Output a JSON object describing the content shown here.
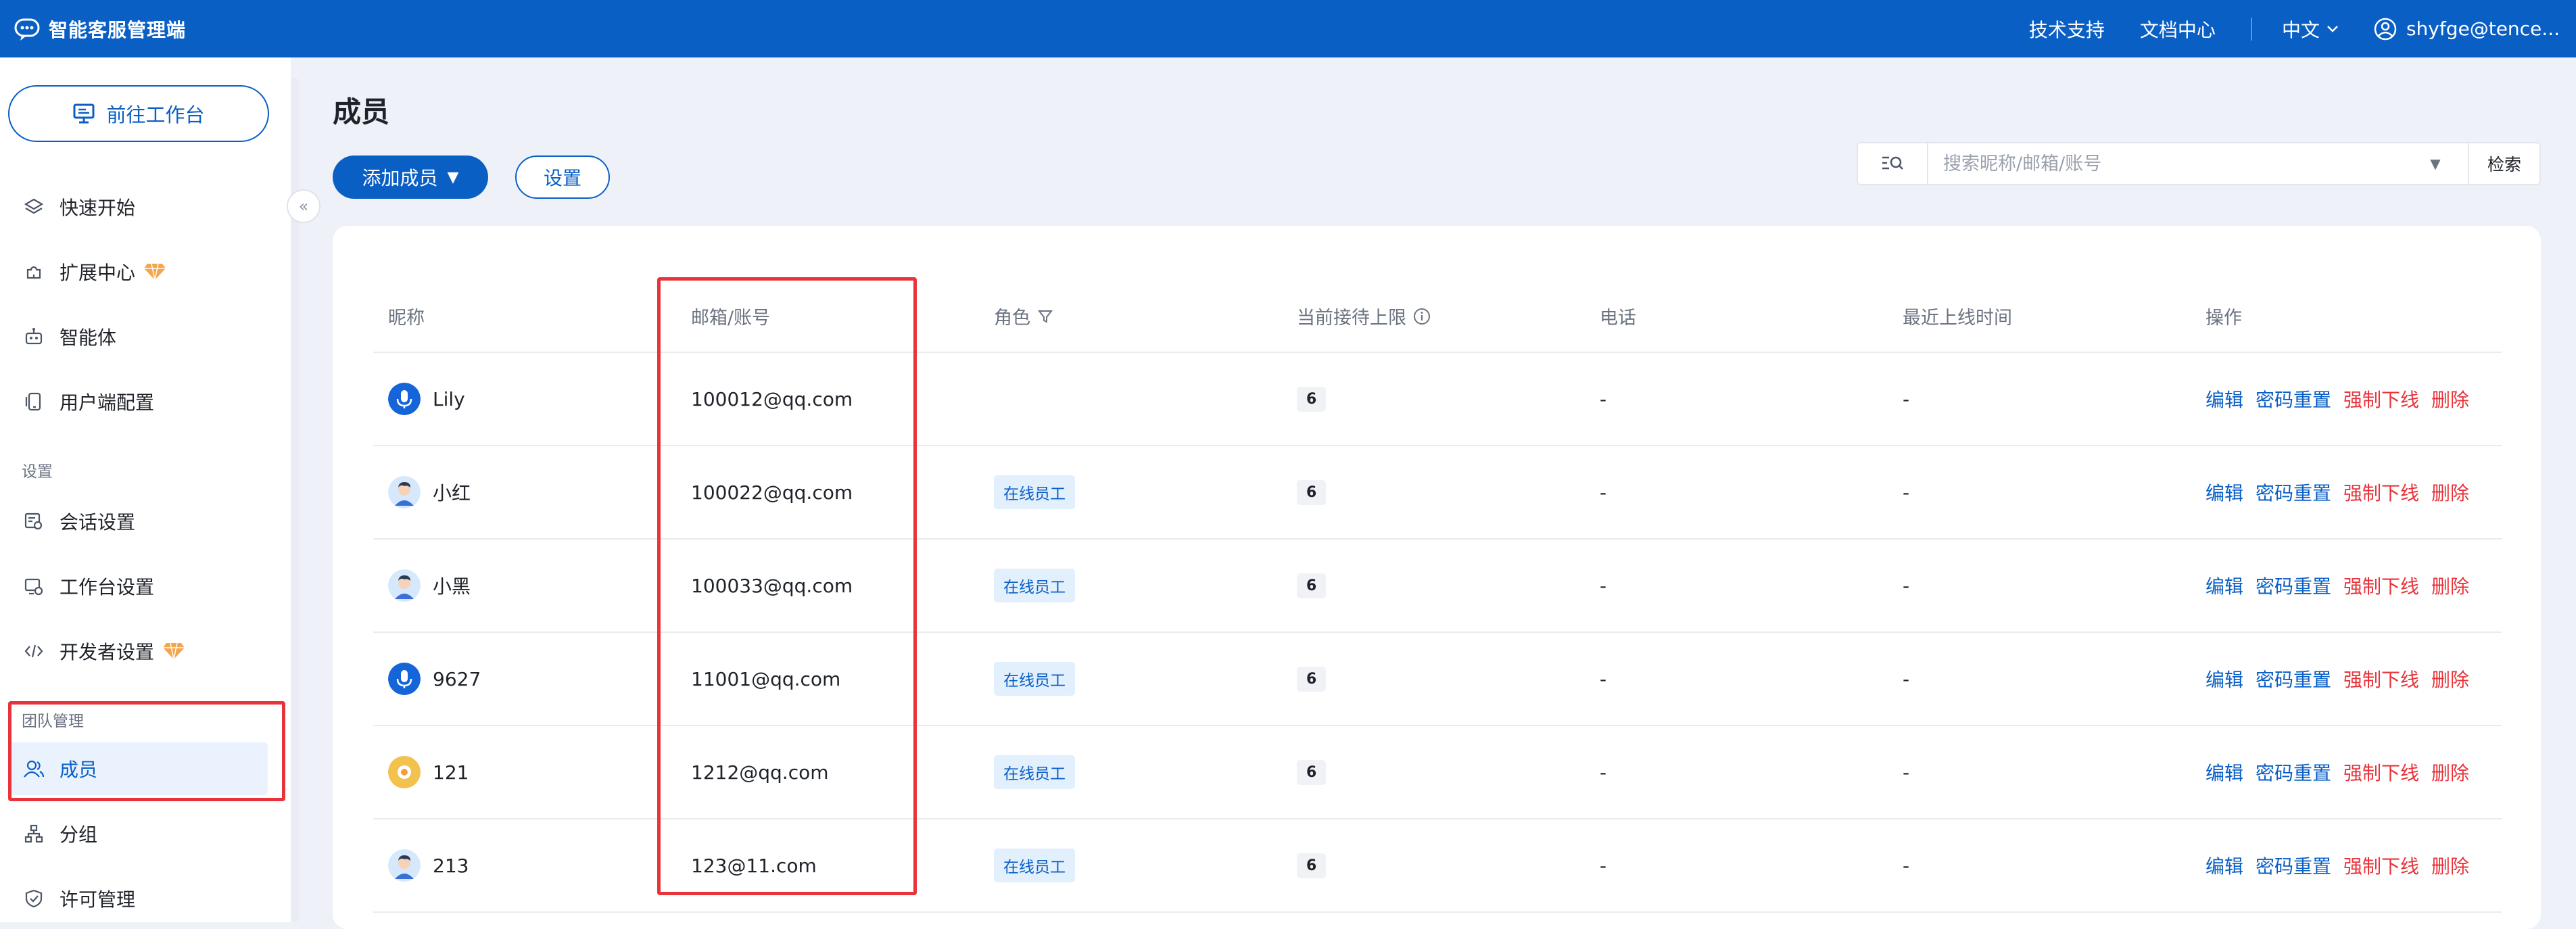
{
  "app": {
    "title": "智能客服管理端"
  },
  "topnav": {
    "support": "技术支持",
    "docs": "文档中心",
    "language": "中文",
    "user": "shyfge@tence..."
  },
  "sidebar": {
    "goto_workbench": "前往工作台",
    "items_top": [
      {
        "label": "快速开始",
        "icon": "layers-icon"
      },
      {
        "label": "扩展中心",
        "icon": "puzzle-icon"
      },
      {
        "label": "智能体",
        "icon": "robot-icon"
      },
      {
        "label": "用户端配置",
        "icon": "phone-icon"
      }
    ],
    "section_settings": "设置",
    "items_settings": [
      {
        "label": "会话设置",
        "icon": "chat-settings-icon"
      },
      {
        "label": "工作台设置",
        "icon": "desktop-settings-icon"
      },
      {
        "label": "开发者设置",
        "icon": "code-icon"
      }
    ],
    "section_team": "团队管理",
    "items_team": [
      {
        "label": "成员",
        "icon": "members-icon"
      },
      {
        "label": "分组",
        "icon": "hierarchy-icon"
      },
      {
        "label": "许可管理",
        "icon": "shield-check-icon"
      }
    ]
  },
  "main": {
    "title": "成员",
    "add_member": "添加成员",
    "settings": "设置",
    "search_placeholder": "搜索昵称/邮箱/账号",
    "search_button": "检索"
  },
  "table": {
    "columns": [
      "昵称",
      "邮箱/账号",
      "角色",
      "当前接待上限",
      "电话",
      "最近上线时间",
      "操作"
    ],
    "actions": {
      "edit": "编辑",
      "reset_password": "密码重置",
      "force_offline": "强制下线",
      "delete": "删除"
    },
    "rows": [
      {
        "nickname": "Lily",
        "email": "100012@qq.com",
        "role": "",
        "limit": "6",
        "phone": "-",
        "last_online": "-",
        "avatar": "mic"
      },
      {
        "nickname": "小红",
        "email": "100022@qq.com",
        "role": "在线员工",
        "limit": "6",
        "phone": "-",
        "last_online": "-",
        "avatar": "person"
      },
      {
        "nickname": "小黑",
        "email": "100033@qq.com",
        "role": "在线员工",
        "limit": "6",
        "phone": "-",
        "last_online": "-",
        "avatar": "person"
      },
      {
        "nickname": "9627",
        "email": "11001@qq.com",
        "role": "在线员工",
        "limit": "6",
        "phone": "-",
        "last_online": "-",
        "avatar": "mic"
      },
      {
        "nickname": "121",
        "email": "1212@qq.com",
        "role": "在线员工",
        "limit": "6",
        "phone": "-",
        "last_online": "-",
        "avatar": "flower"
      },
      {
        "nickname": "213",
        "email": "123@11.com",
        "role": "在线员工",
        "limit": "6",
        "phone": "-",
        "last_online": "-",
        "avatar": "person"
      }
    ]
  },
  "colors": {
    "brand": "#0a5fc5",
    "danger": "#e8333a",
    "highlight": "#e8333a",
    "tag_bg": "#e2effd"
  }
}
